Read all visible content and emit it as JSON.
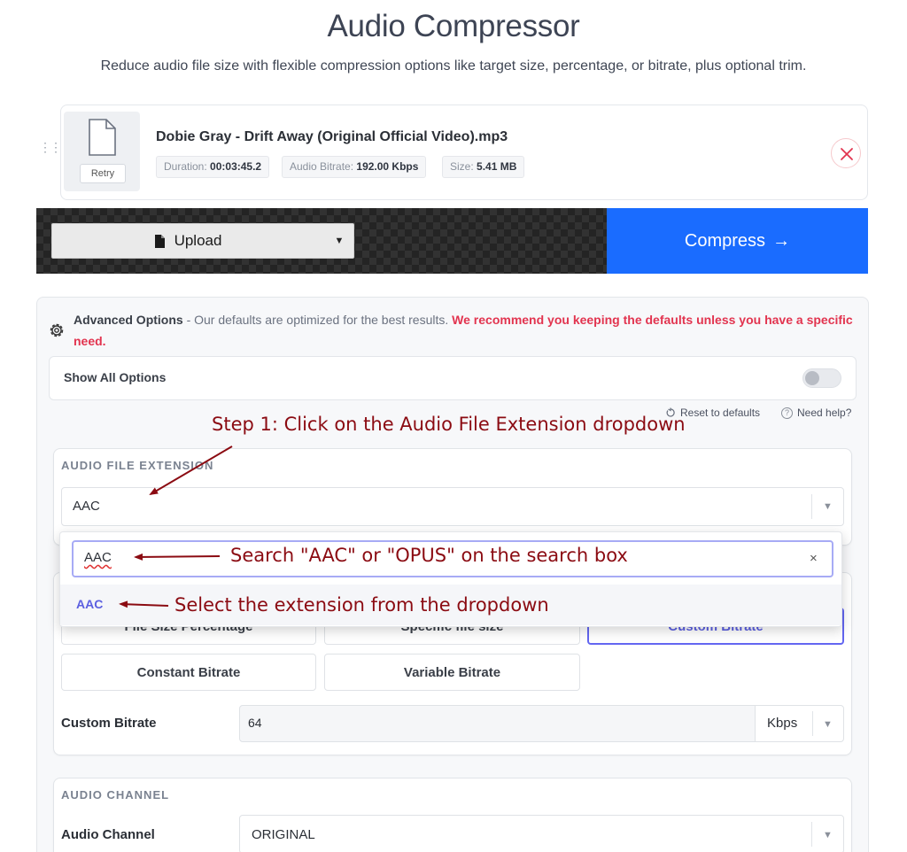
{
  "page": {
    "title": "Audio Compressor",
    "subtitle": "Reduce audio file size with flexible compression options like target size, percentage, or bitrate, plus optional trim."
  },
  "file": {
    "name": "Dobie Gray - Drift Away (Original Official Video).mp3",
    "retry_label": "Retry",
    "duration_label": "Duration:",
    "duration_value": "00:03:45.2",
    "bitrate_label": "Audio Bitrate:",
    "bitrate_value": "192.00 Kbps",
    "size_label": "Size:",
    "size_value": "5.41 MB",
    "remove_icon": "close-icon"
  },
  "actions": {
    "upload_label": "Upload",
    "compress_label": "Compress",
    "compress_arrow": "→"
  },
  "advanced": {
    "title": "Advanced Options",
    "description": " - Our defaults are optimized for the best results. ",
    "warning": "We recommend you keeping the defaults unless you have a specific need.",
    "show_all_label": "Show All Options",
    "show_all_enabled": false,
    "reset_label": "Reset to defaults",
    "help_label": "Need help?"
  },
  "extension": {
    "section_label": "AUDIO FILE EXTENSION",
    "selected": "AAC",
    "search_text": "AAC",
    "clear_symbol": "×",
    "options": [
      "AAC"
    ]
  },
  "bitrate": {
    "options": [
      "File Size Percentage",
      "Specific file size",
      "Custom Bitrate",
      "Constant Bitrate",
      "Variable Bitrate"
    ],
    "active": "Custom Bitrate",
    "custom_label": "Custom Bitrate",
    "custom_value": "64",
    "unit": "Kbps"
  },
  "channel": {
    "section_label": "AUDIO CHANNEL",
    "label": "Audio Channel",
    "value": "ORIGINAL"
  },
  "annotations": {
    "step1": "Step 1: Click on the Audio File Extension dropdown",
    "search_hint": "Search \"AAC\" or \"OPUS\" on the search box",
    "select_hint": "Select the extension from the dropdown",
    "color": "#8b0b12"
  },
  "colors": {
    "accent": "#1a6cff",
    "warning": "#e2344f",
    "selection": "#5b5fe0"
  }
}
